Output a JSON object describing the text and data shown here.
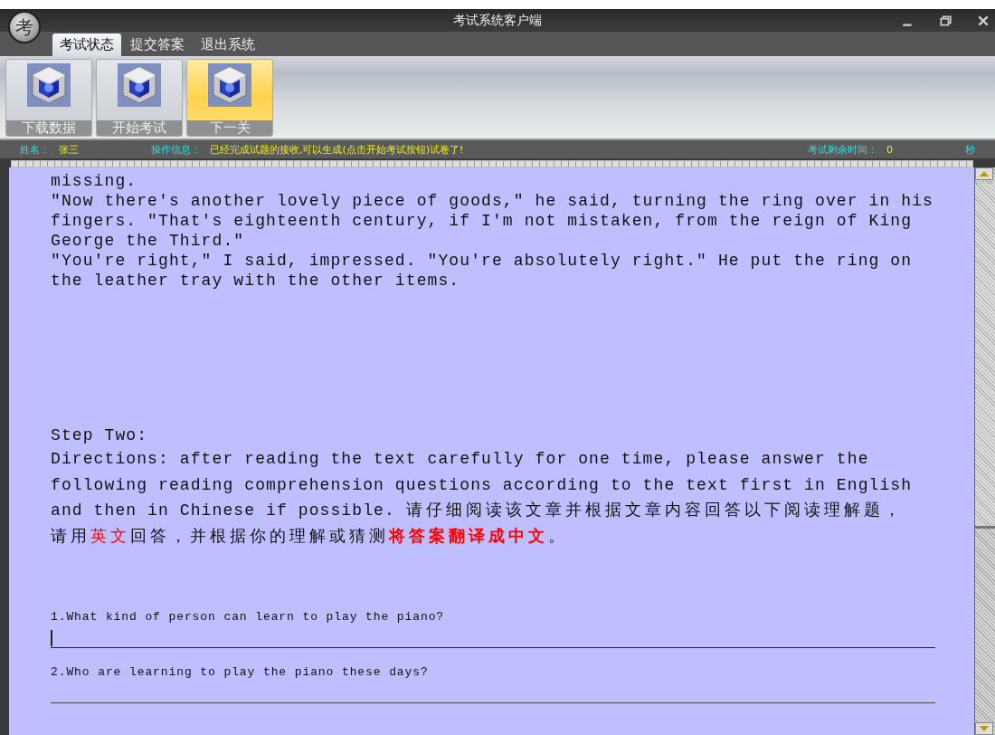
{
  "window": {
    "logo": "考",
    "title": "考试系统客户端"
  },
  "tabs": [
    {
      "label": "考试状态",
      "selected": true
    },
    {
      "label": "提交答案",
      "selected": false
    },
    {
      "label": "退出系统",
      "selected": false
    }
  ],
  "toolbar": [
    {
      "label": "下载数据",
      "selected": false
    },
    {
      "label": "开始考试",
      "selected": false
    },
    {
      "label": "下一关",
      "selected": true
    }
  ],
  "status_bar": {
    "name_label": "姓名：",
    "name": "张三",
    "info_label": "操作信息：",
    "info": "已经完成试题的接收,可以生成(点击开始考试按钮)试卷了!",
    "time_label": "考试剩余时间：",
    "time": "0",
    "unit": "秒"
  },
  "passage": [
    "missing.",
    "\"Now there's another lovely piece of goods,\" he said, turning the ring over in his\nfingers. \"That's eighteenth century, if I'm not mistaken, from the reign of King\nGeorge the Third.\"",
    "\"You're right,\" I said, impressed. \"You're absolutely right.\" He put the ring on\nthe leather tray with the other items."
  ],
  "step_title": "Step Two:",
  "directions": [
    {
      "kind": "latin",
      "text": "Directions: after reading the text carefully for one time, please answer the \nfollowing reading comprehension questions according to the text first in English \nand then in Chinese if possible. ",
      "red": false,
      "bold": false
    },
    {
      "kind": "cjk",
      "text": "请仔细阅读该文章并根据文章内容回答以下阅读理解题，请用",
      "red": false,
      "bold": false
    },
    {
      "kind": "cjk",
      "text": "英文",
      "red": true,
      "bold": false
    },
    {
      "kind": "cjk",
      "text": "回答，并根据你的理解或猜测",
      "red": false,
      "bold": false
    },
    {
      "kind": "cjk",
      "text": "将答案翻译成中文",
      "red": true,
      "bold": true
    },
    {
      "kind": "cjk",
      "text": "。",
      "red": false,
      "bold": false
    }
  ],
  "questions": [
    {
      "text": "1.What kind of person can learn to play the piano?",
      "focused": true
    },
    {
      "text": "2.Who are learning to play the piano these days?",
      "focused": false
    }
  ]
}
